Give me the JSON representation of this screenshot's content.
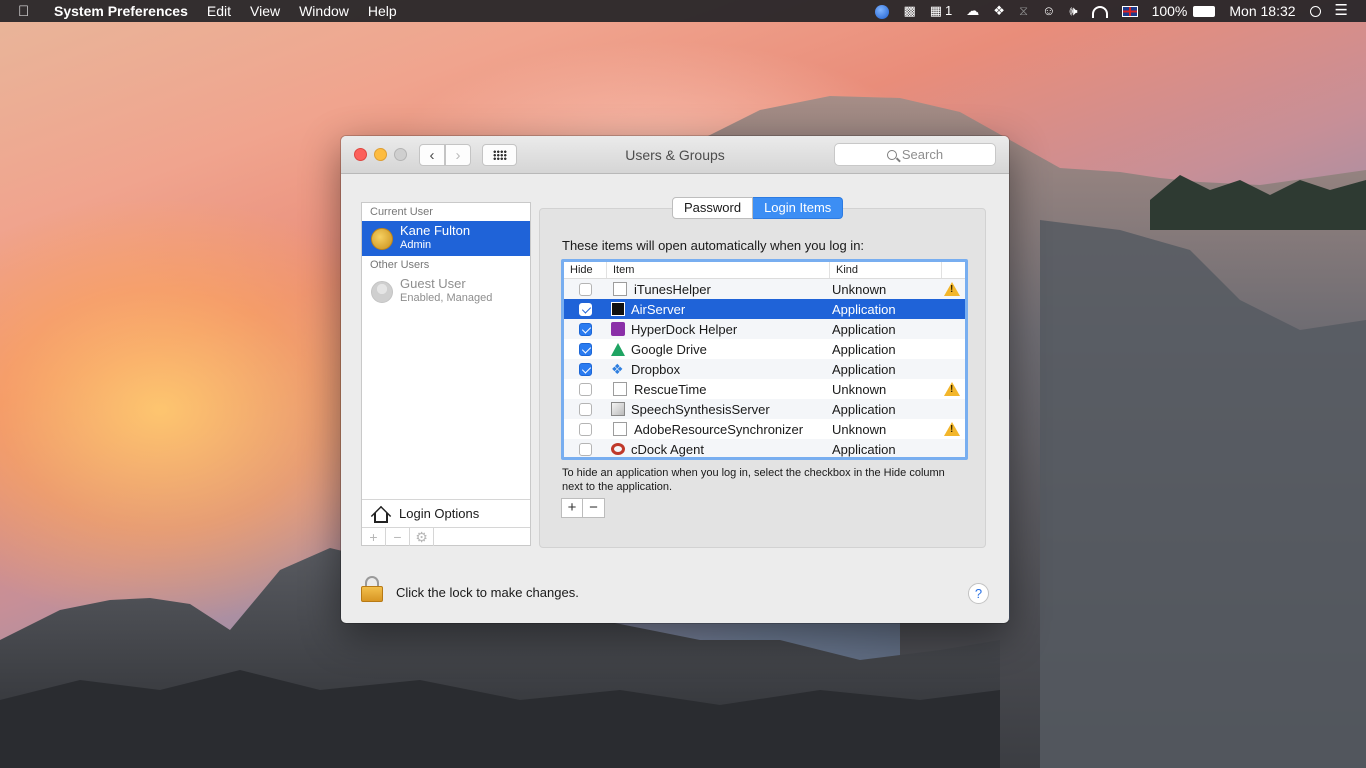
{
  "menubar": {
    "app_name": "System Preferences",
    "menus": [
      "Edit",
      "View",
      "Window",
      "Help"
    ],
    "status": {
      "notification_count": "1",
      "battery": "100%",
      "clock": "Mon 18:32"
    },
    "status_icons": [
      "globe-icon",
      "evernote-icon",
      "adobe-icon",
      "creative-cloud-icon",
      "dropbox-icon",
      "bluetooth-icon",
      "accessibility-icon",
      "volume-icon",
      "wifi-icon",
      "uk-flag-icon",
      "battery-icon",
      "spotlight-icon",
      "notification-center-icon"
    ]
  },
  "window": {
    "title": "Users & Groups",
    "search_placeholder": "Search"
  },
  "sidebar": {
    "current_user_header": "Current User",
    "current_user": {
      "name": "Kane Fulton",
      "role": "Admin"
    },
    "other_users_header": "Other Users",
    "other_users": [
      {
        "name": "Guest User",
        "status": "Enabled, Managed"
      }
    ],
    "login_options_label": "Login Options",
    "bar_buttons": [
      "+",
      "−",
      "⚙"
    ]
  },
  "tabs": [
    {
      "label": "Password",
      "active": false
    },
    {
      "label": "Login Items",
      "active": true
    }
  ],
  "login_items": {
    "intro": "These items will open automatically when you log in:",
    "columns": {
      "hide": "Hide",
      "item": "Item",
      "kind": "Kind"
    },
    "rows": [
      {
        "hide": false,
        "item": "iTunesHelper",
        "kind": "Unknown",
        "warning": true,
        "icon": "document-icon",
        "selected": false
      },
      {
        "hide": true,
        "item": "AirServer",
        "kind": "Application",
        "warning": false,
        "icon": "airserver-icon",
        "selected": true
      },
      {
        "hide": true,
        "item": "HyperDock Helper",
        "kind": "Application",
        "warning": false,
        "icon": "hyperdock-icon",
        "selected": false
      },
      {
        "hide": true,
        "item": "Google Drive",
        "kind": "Application",
        "warning": false,
        "icon": "google-drive-icon",
        "selected": false
      },
      {
        "hide": true,
        "item": "Dropbox",
        "kind": "Application",
        "warning": false,
        "icon": "dropbox-icon",
        "selected": false
      },
      {
        "hide": false,
        "item": "RescueTime",
        "kind": "Unknown",
        "warning": true,
        "icon": "document-icon",
        "selected": false
      },
      {
        "hide": false,
        "item": "SpeechSynthesisServer",
        "kind": "Application",
        "warning": false,
        "icon": "speech-icon",
        "selected": false
      },
      {
        "hide": false,
        "item": "AdobeResourceSynchronizer",
        "kind": "Unknown",
        "warning": true,
        "icon": "document-icon",
        "selected": false
      },
      {
        "hide": false,
        "item": "cDock Agent",
        "kind": "Application",
        "warning": false,
        "icon": "cdock-icon",
        "selected": false
      }
    ],
    "help_text": "To hide an application when you log in, select the checkbox in the Hide column next to the application.",
    "add_label": "+",
    "remove_label": "−"
  },
  "footer": {
    "lock_text": "Click the lock to make changes.",
    "help_label": "?"
  },
  "colors": {
    "selection": "#1f63d8",
    "tab_active": "#3c8ef4",
    "close": "#fc605b",
    "minimize": "#fdbc40",
    "warning": "#f3b62b"
  }
}
